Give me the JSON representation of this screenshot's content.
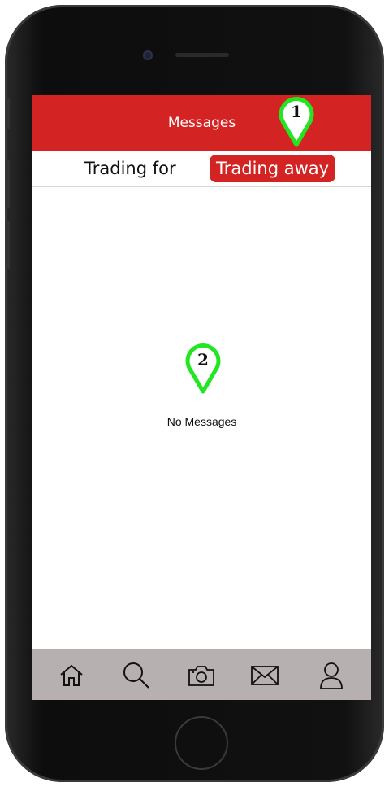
{
  "header": {
    "title": "Messages"
  },
  "tabs": [
    {
      "label": "Trading for",
      "active": false
    },
    {
      "label": "Trading away",
      "active": true
    }
  ],
  "main": {
    "empty_text": "No Messages"
  },
  "nav": [
    {
      "name": "home-icon"
    },
    {
      "name": "search-icon"
    },
    {
      "name": "camera-icon"
    },
    {
      "name": "mail-icon"
    },
    {
      "name": "profile-icon"
    }
  ],
  "annotations": [
    {
      "label": "1"
    },
    {
      "label": "2"
    }
  ],
  "colors": {
    "accent": "#d42323",
    "nav_bg": "#b7b0b0",
    "marker": "#22e622"
  }
}
